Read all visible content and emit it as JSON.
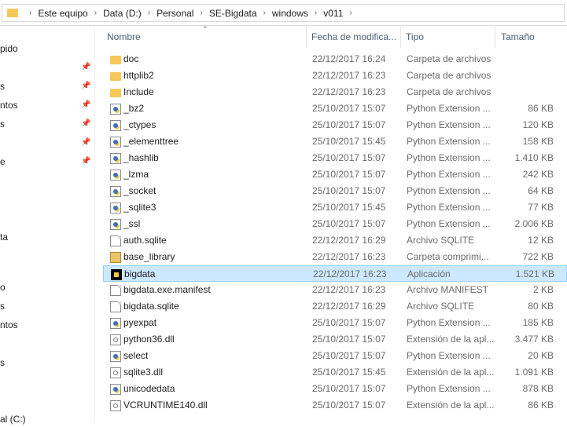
{
  "address_bar": {
    "breadcrumbs": [
      "Este equipo",
      "Data (D:)",
      "Personal",
      "SE-Bigdata",
      "windows",
      "v011"
    ]
  },
  "nav_pane": {
    "items": [
      {
        "label": "pido",
        "pinned": false
      },
      {
        "label": "",
        "pinned": true
      },
      {
        "label": "s",
        "pinned": true
      },
      {
        "label": "ntos",
        "pinned": true
      },
      {
        "label": "s",
        "pinned": true
      },
      {
        "label": "",
        "pinned": true
      },
      {
        "label": "e",
        "pinned": true
      },
      {
        "label": "ta",
        "pinned": false
      },
      {
        "label": "o",
        "pinned": false
      },
      {
        "label": "s",
        "pinned": false
      },
      {
        "label": "ntos",
        "pinned": false
      },
      {
        "label": "s",
        "pinned": false
      },
      {
        "label": "al (C:)",
        "pinned": false
      }
    ]
  },
  "columns": {
    "name": "Nombre",
    "date": "Fecha de modifica...",
    "type": "Tipo",
    "size": "Tamaño"
  },
  "files": [
    {
      "name": "doc",
      "date": "22/12/2017 16:24",
      "type": "Carpeta de archivos",
      "size": "",
      "icon": "folder-icon"
    },
    {
      "name": "httplib2",
      "date": "22/12/2017 16:23",
      "type": "Carpeta de archivos",
      "size": "",
      "icon": "folder-icon"
    },
    {
      "name": "Include",
      "date": "22/12/2017 16:23",
      "type": "Carpeta de archivos",
      "size": "",
      "icon": "folder-icon"
    },
    {
      "name": "_bz2",
      "date": "25/10/2017 15:07",
      "type": "Python Extension ...",
      "size": "86 KB",
      "icon": "python-file-icon"
    },
    {
      "name": "_ctypes",
      "date": "25/10/2017 15:07",
      "type": "Python Extension ...",
      "size": "120 KB",
      "icon": "python-file-icon"
    },
    {
      "name": "_elementtree",
      "date": "25/10/2017 15:45",
      "type": "Python Extension ...",
      "size": "158 KB",
      "icon": "python-file-icon"
    },
    {
      "name": "_hashlib",
      "date": "25/10/2017 15:07",
      "type": "Python Extension ...",
      "size": "1.410 KB",
      "icon": "python-file-icon"
    },
    {
      "name": "_lzma",
      "date": "25/10/2017 15:07",
      "type": "Python Extension ...",
      "size": "242 KB",
      "icon": "python-file-icon"
    },
    {
      "name": "_socket",
      "date": "25/10/2017 15:07",
      "type": "Python Extension ...",
      "size": "64 KB",
      "icon": "python-file-icon"
    },
    {
      "name": "_sqlite3",
      "date": "25/10/2017 15:45",
      "type": "Python Extension ...",
      "size": "77 KB",
      "icon": "python-file-icon"
    },
    {
      "name": "_ssl",
      "date": "25/10/2017 15:07",
      "type": "Python Extension ...",
      "size": "2.006 KB",
      "icon": "python-file-icon"
    },
    {
      "name": "auth.sqlite",
      "date": "22/12/2017 16:29",
      "type": "Archivo SQLITE",
      "size": "12 KB",
      "icon": "document-icon"
    },
    {
      "name": "base_library",
      "date": "22/12/2017 16:23",
      "type": "Carpeta comprimi...",
      "size": "722 KB",
      "icon": "zip-folder-icon"
    },
    {
      "name": "bigdata",
      "date": "22/12/2017 16:23",
      "type": "Aplicación",
      "size": "1.521 KB",
      "icon": "application-icon",
      "selected": true
    },
    {
      "name": "bigdata.exe.manifest",
      "date": "22/12/2017 16:23",
      "type": "Archivo MANIFEST",
      "size": "2 KB",
      "icon": "document-icon"
    },
    {
      "name": "bigdata.sqlite",
      "date": "22/12/2017 16:29",
      "type": "Archivo SQLITE",
      "size": "80 KB",
      "icon": "document-icon"
    },
    {
      "name": "pyexpat",
      "date": "25/10/2017 15:07",
      "type": "Python Extension ...",
      "size": "185 KB",
      "icon": "python-file-icon"
    },
    {
      "name": "python36.dll",
      "date": "25/10/2017 15:07",
      "type": "Extensión de la apl...",
      "size": "3.477 KB",
      "icon": "dll-file-icon"
    },
    {
      "name": "select",
      "date": "25/10/2017 15:07",
      "type": "Python Extension ...",
      "size": "20 KB",
      "icon": "python-file-icon"
    },
    {
      "name": "sqlite3.dll",
      "date": "25/10/2017 15:45",
      "type": "Extensión de la apl...",
      "size": "1.091 KB",
      "icon": "dll-file-icon"
    },
    {
      "name": "unicodedata",
      "date": "25/10/2017 15:07",
      "type": "Python Extension ...",
      "size": "878 KB",
      "icon": "python-file-icon"
    },
    {
      "name": "VCRUNTIME140.dll",
      "date": "25/10/2017 15:07",
      "type": "Extensión de la apl...",
      "size": "86 KB",
      "icon": "dll-file-icon"
    }
  ]
}
